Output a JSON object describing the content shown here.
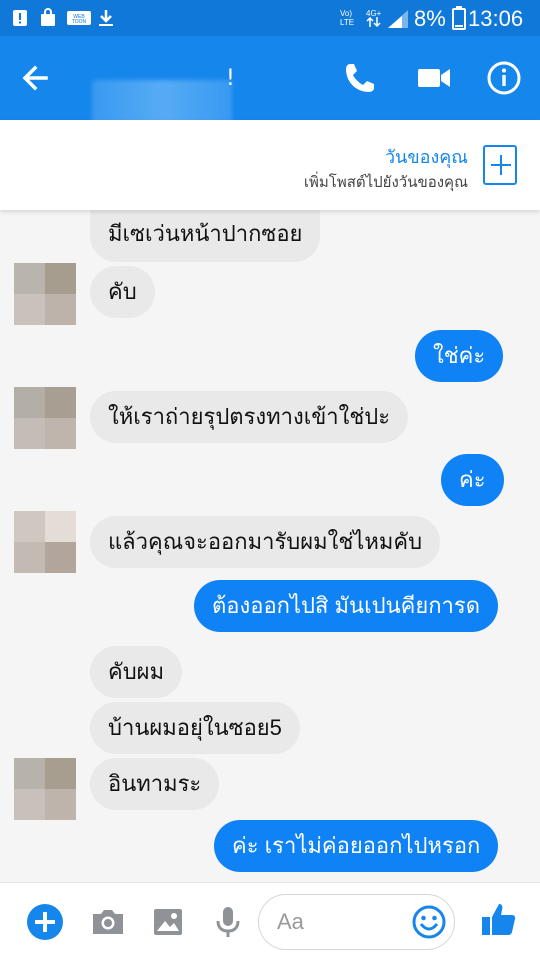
{
  "status_bar": {
    "volte_line1": "Vo)",
    "volte_line2": "LTE",
    "network": "4G+",
    "battery": "8%",
    "time": "13:06"
  },
  "header": {
    "contact_name": "!",
    "icons": [
      "back-arrow-icon",
      "phone-icon",
      "video-camera-icon",
      "info-icon"
    ]
  },
  "story": {
    "title": "วันของคุณ",
    "subtitle": "เพิ่มโพสต์ไปยังวันของคุณ"
  },
  "messages": [
    {
      "from": "them",
      "text": "มีเซเว่นหน้าปากซอย"
    },
    {
      "from": "them",
      "text": "คับ"
    },
    {
      "from": "me",
      "text": "ใช่ค่ะ"
    },
    {
      "from": "them",
      "text": "ให้เราถ่ายรุปตรงทางเข้าใช่ปะ"
    },
    {
      "from": "me",
      "text": "ค่ะ"
    },
    {
      "from": "them",
      "text": "แล้วคุณจะออกมารับผมใช่ไหมคับ"
    },
    {
      "from": "me",
      "text": "ต้องออกไปสิ มันเปนคียการด"
    },
    {
      "from": "them",
      "text": "คับผม"
    },
    {
      "from": "them",
      "text": "บ้านผมอยุ่ในซอย5"
    },
    {
      "from": "them",
      "text": "อินทามระ"
    },
    {
      "from": "me",
      "text": "ค่ะ เราไม่ค่อยออกไปหรอก"
    }
  ],
  "composer": {
    "placeholder": "Aa",
    "icons": [
      "plus-icon",
      "camera-icon",
      "image-icon",
      "microphone-icon",
      "emoji-icon",
      "thumbs-up-icon"
    ]
  },
  "colors": {
    "brand_blue": "#1586ec",
    "status_blue": "#0f78d9",
    "outgoing_bubble": "#0f83f5",
    "incoming_bubble": "#e9e9e9"
  }
}
